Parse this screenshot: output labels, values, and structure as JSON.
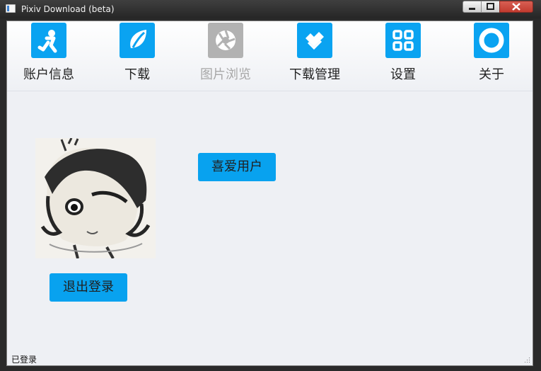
{
  "window": {
    "title": "Pixiv Download (beta)",
    "icon": "app-window-icon"
  },
  "nav": {
    "items": [
      {
        "label": "账户信息",
        "icon": "account-icon",
        "disabled": false
      },
      {
        "label": "下载",
        "icon": "download-leaf-icon",
        "disabled": false
      },
      {
        "label": "图片浏览",
        "icon": "camera-shutter-icon",
        "disabled": true
      },
      {
        "label": "下载管理",
        "icon": "download-manage-icon",
        "disabled": false
      },
      {
        "label": "设置",
        "icon": "settings-grid-icon",
        "disabled": false
      },
      {
        "label": "关于",
        "icon": "about-ring-icon",
        "disabled": false
      }
    ]
  },
  "main": {
    "favorite_users_button": "喜爱用户",
    "logout_button": "退出登录"
  },
  "statusbar": {
    "text": "已登录"
  },
  "colors": {
    "accent": "#0aa3f1",
    "disabled": "#b2b2b2",
    "client_bg": "#eef0f4"
  }
}
